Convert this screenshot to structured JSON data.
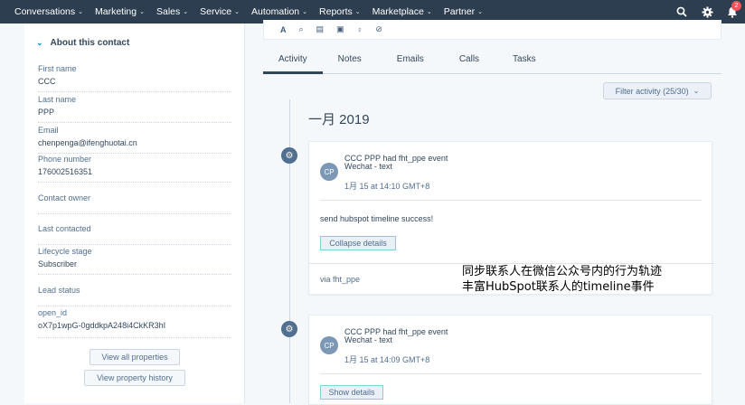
{
  "nav": {
    "items": [
      "Conversations",
      "Marketing",
      "Sales",
      "Service",
      "Automation",
      "Reports",
      "Marketplace",
      "Partner"
    ],
    "notification_count": "2"
  },
  "about": {
    "header": "About this contact",
    "properties": [
      {
        "label": "First name",
        "value": "CCC"
      },
      {
        "label": "Last name",
        "value": "PPP"
      },
      {
        "label": "Email",
        "value": "chenpenga@ifenghuotai.cn"
      },
      {
        "label": "Phone number",
        "value": "176002516351"
      },
      {
        "label": "Contact owner",
        "value": ""
      },
      {
        "label": "Last contacted",
        "value": ""
      },
      {
        "label": "Lifecycle stage",
        "value": "Subscriber"
      },
      {
        "label": "Lead status",
        "value": ""
      },
      {
        "label": "open_id",
        "value": "oX7p1wpG-0gddkpA248i4CkKR3hI"
      }
    ],
    "view_all_label": "View all properties",
    "view_history_label": "View property history"
  },
  "toolbar": {
    "tools": [
      "A",
      "⌕",
      "▤",
      "▣",
      "♀",
      "⊘"
    ]
  },
  "tabs": [
    "Activity",
    "Notes",
    "Emails",
    "Calls",
    "Tasks"
  ],
  "filter": {
    "label": "Filter activity (25/30)"
  },
  "timeline": {
    "month": "一月 2019",
    "events": [
      {
        "initials": "CP",
        "title": "CCC PPP had fht_ppe event",
        "subtitle": "Wechat - text",
        "time": "1月 15 at 14:10 GMT+8",
        "body": "send hubspot timeline success!",
        "details_label": "Collapse details",
        "via": "via fht_ppe"
      },
      {
        "initials": "CP",
        "title": "CCC PPP had fht_ppe event",
        "subtitle": "Wechat - text",
        "time": "1月 15 at 14:09 GMT+8",
        "details_label": "Show details"
      }
    ]
  },
  "annotation": {
    "line1": "同步联系人在微信公众号内的行为轨迹",
    "line2": "丰富HubSpot联系人的timeline事件"
  }
}
